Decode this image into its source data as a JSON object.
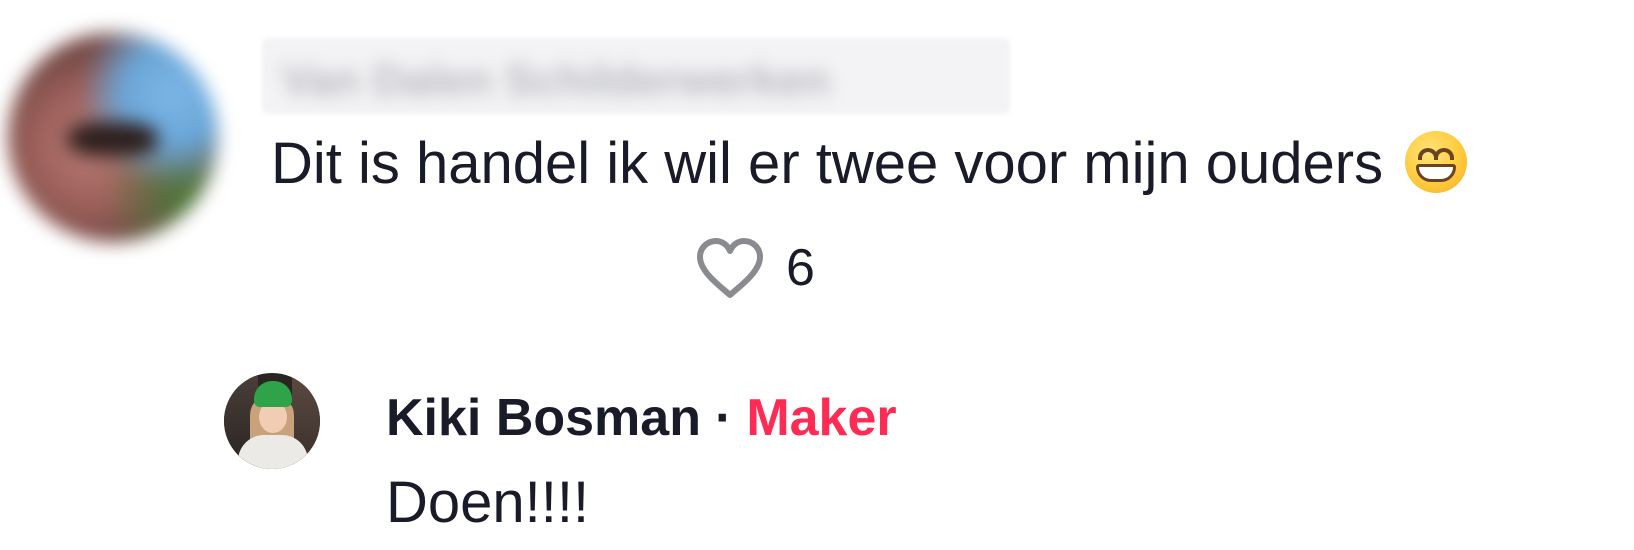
{
  "comment": {
    "username": "Van Dalen Schilderwerken",
    "text": "Dit is handel ik wil er twee voor mijn ouders",
    "emoji": "grinning-face-with-smiling-eyes",
    "likes": "6"
  },
  "reply": {
    "author": "Kiki Bosman",
    "separator": "·",
    "badge": "Maker",
    "text": "Doen!!!!"
  },
  "colors": {
    "text": "#1a1b28",
    "creator_badge": "#fe2c55",
    "heart_outline": "#8a8b91"
  }
}
